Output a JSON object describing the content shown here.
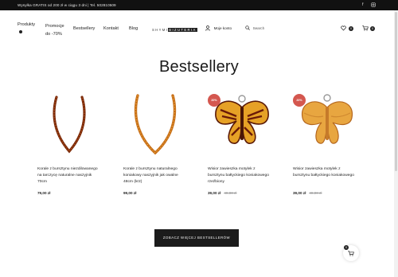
{
  "topbar": {
    "promo": "Wysyłka GRATIS od 200 zł w ciągu 3 dni | Tel. 502810509",
    "social": [
      "facebook-icon",
      "instagram-icon"
    ]
  },
  "nav": {
    "products": "Produkty",
    "promo_line1": "Promocje",
    "promo_line2": "do -70%",
    "bestsellers": "Bestsellery",
    "contact": "Kontakt",
    "blog": "Blog",
    "logo_left": "SHYMI",
    "logo_right": "BIZUTERIA",
    "account": "Moje konto",
    "search_placeholder": "Search",
    "wishlist_count": "0",
    "cart_count": "0"
  },
  "main": {
    "heading": "Bestsellery",
    "cta": "ZOBACZ WIĘCEJ BESTSELLERÓW",
    "floating_cart_count": "0"
  },
  "products": [
    {
      "name": "Korale z bursztynu niezdilowanego na tarczycę naturalne naszyjnik 70cm",
      "price": "79,00 zł",
      "old_price": "",
      "badge": ""
    },
    {
      "name": "Korale z bursztynu naturalnego koniakowy naszyjnik jak owalne 48cm (kr2)",
      "price": "99,00 zł",
      "old_price": "",
      "badge": ""
    },
    {
      "name": "Wisior zawieszka motylek z bursztynu bałtyckiego koniakowego rzeźbiony",
      "price": "39,00 zł",
      "old_price": "49,00 zł",
      "badge": "20%"
    },
    {
      "name": "Wisior zawieszka motylek z bursztynu bałtyckiego koniakowego",
      "price": "39,00 zł",
      "old_price": "49,00 zł",
      "badge": "20%"
    }
  ],
  "colors": {
    "topbar": "#111111",
    "sale_badge": "#d4574f",
    "cta": "#1b1b1b",
    "amber_dark": "#8a2f0a",
    "amber_light": "#e09a2a"
  }
}
